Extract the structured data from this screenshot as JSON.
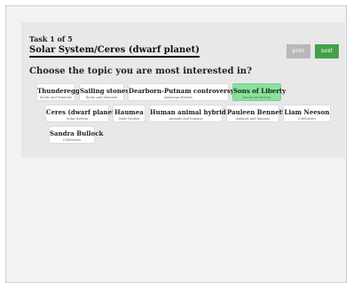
{
  "task": {
    "counter": "Task 1 of 5",
    "title": "Solar System/Ceres (dwarf planet)",
    "prev_label": "prev",
    "next_label": "next",
    "prompt": "Choose the topic you are most interested in?"
  },
  "topics": [
    {
      "name": "Thunderegg",
      "category": "Rocks and Minerals",
      "selected": false
    },
    {
      "name": "Sailing stones",
      "category": "Rocks and Minerals",
      "selected": false
    },
    {
      "name": "Dearborn-Putnam controversy",
      "category": "American History",
      "selected": false
    },
    {
      "name": "Sons of Liberty",
      "category": "American History",
      "selected": true
    },
    {
      "name": "Ceres (dwarf planet)",
      "category": "Solar System",
      "selected": false
    },
    {
      "name": "Haumea",
      "category": "Solar System",
      "selected": false
    },
    {
      "name": "Human animal hybrid",
      "category": "Animals and humans",
      "selected": false
    },
    {
      "name": "Pauleen Bennett",
      "category": "Animals and humans",
      "selected": false
    },
    {
      "name": "Liam Neeson",
      "category": "Celebrities",
      "selected": false
    },
    {
      "name": "Sandra Bullock",
      "category": "Celebrities",
      "selected": false
    }
  ],
  "colors": {
    "next_button": "#45a049",
    "prev_button": "#b8b8b8",
    "selected_topic": "#86e39b"
  }
}
